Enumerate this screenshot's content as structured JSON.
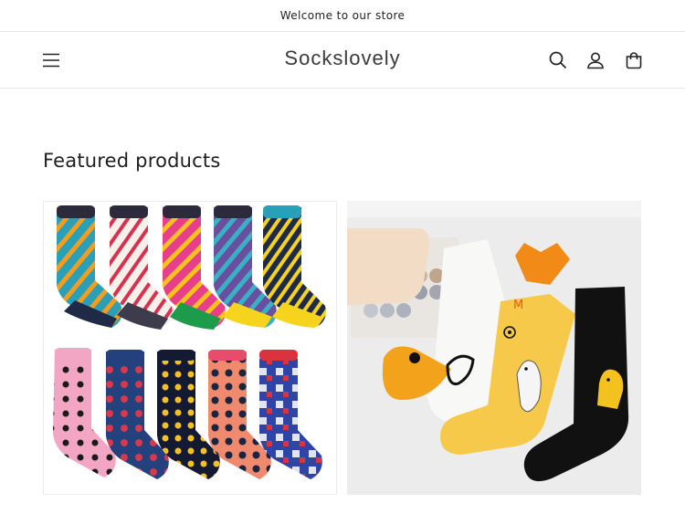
{
  "announcement": {
    "text": "Welcome to our store"
  },
  "header": {
    "brand": "Sockslovely",
    "icons": [
      "menu-icon",
      "search-icon",
      "account-icon",
      "cart-icon"
    ]
  },
  "featured": {
    "title": "Featured products",
    "products": [
      {
        "image": "argyle-polka-dot-socks-set"
      },
      {
        "image": "duck-beak-novelty-socks"
      }
    ]
  },
  "colors": {
    "text": "#121212",
    "border": "#e6e6e6",
    "background": "#ffffff"
  }
}
